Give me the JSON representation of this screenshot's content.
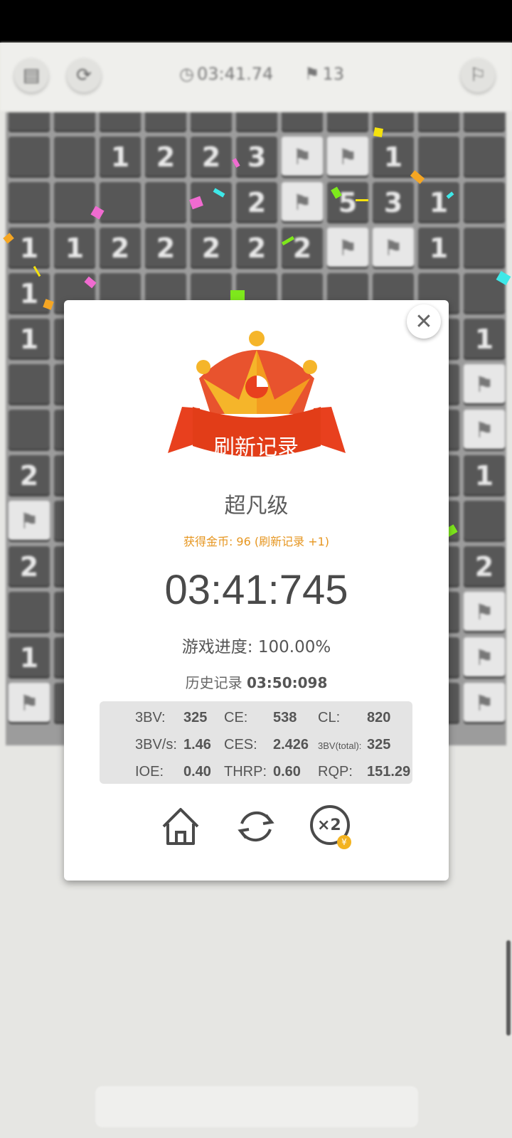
{
  "toolbar": {
    "timer": "03:41.74",
    "flags": "13"
  },
  "board": {
    "rows": [
      [
        "",
        "",
        "",
        "",
        "",
        "",
        "",
        "",
        "",
        "",
        ""
      ],
      [
        "",
        "",
        "1",
        "2",
        "2",
        "3",
        "F",
        "F",
        "1",
        "",
        ""
      ],
      [
        "",
        "",
        "",
        "",
        "",
        "2",
        "F",
        "5",
        "3",
        "1",
        ""
      ],
      [
        "1",
        "1",
        "2",
        "2",
        "2",
        "2",
        "2",
        "F",
        "F",
        "1",
        ""
      ],
      [
        "1",
        "",
        "",
        "",
        "",
        "",
        "",
        "",
        "",
        "",
        ""
      ],
      [
        "1",
        "",
        "",
        "",
        "",
        "",
        "",
        "",
        "",
        "",
        "1"
      ],
      [
        "",
        "",
        "",
        "",
        "",
        "",
        "",
        "",
        "",
        "",
        "F"
      ],
      [
        "",
        "",
        "",
        "",
        "",
        "",
        "",
        "",
        "",
        "",
        "F"
      ],
      [
        "2",
        "",
        "",
        "",
        "",
        "",
        "",
        "",
        "",
        "",
        "1"
      ],
      [
        "F",
        "",
        "",
        "",
        "",
        "",
        "",
        "",
        "",
        "",
        ""
      ],
      [
        "2",
        "",
        "",
        "",
        "",
        "",
        "",
        "",
        "",
        "",
        "2"
      ],
      [
        "",
        "",
        "",
        "",
        "",
        "",
        "",
        "",
        "",
        "",
        "F"
      ],
      [
        "1",
        "",
        "",
        "",
        "",
        "",
        "",
        "",
        "",
        "",
        "F"
      ],
      [
        "F",
        "",
        "",
        "",
        "",
        "",
        "",
        "",
        "",
        "",
        "F"
      ]
    ]
  },
  "modal": {
    "banner": "刷新记录",
    "level": "超凡级",
    "coins": "获得金币: 96 (刷新记录 +1)",
    "time": "03:41:745",
    "progress": "游戏进度: 100.00%",
    "history_label": "历史记录",
    "history_value": "03:50:098",
    "stats": {
      "bv_label": "3BV:",
      "bv": "325",
      "ce_label": "CE:",
      "ce": "538",
      "cl_label": "CL:",
      "cl": "820",
      "bvs_label": "3BV/s:",
      "bvs": "1.46",
      "ces_label": "CES:",
      "ces": "2.426",
      "bvtotal_label": "3BV(total):",
      "bvtotal": "325",
      "ioe_label": "IOE:",
      "ioe": "0.40",
      "thrp_label": "THRP:",
      "thrp": "0.60",
      "rqp_label": "RQP:",
      "rqp": "151.29"
    },
    "double_label": "×2",
    "coin_glyph": "¥"
  },
  "colors": {
    "accent": "#e69620",
    "ribbon": "#e8401e",
    "crown": "#f5b52a"
  }
}
